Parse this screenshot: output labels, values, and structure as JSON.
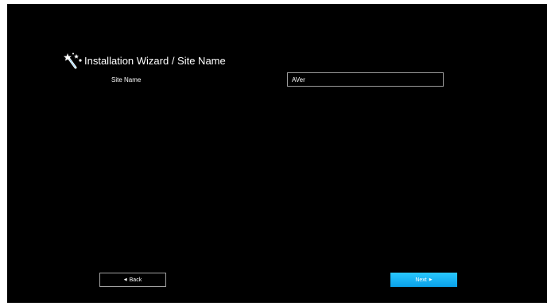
{
  "header": {
    "icon": "magic-wand-icon",
    "title": "Installation Wizard / Site Name"
  },
  "form": {
    "site_name_label": "Site Name",
    "site_name_value": "AVer"
  },
  "footer": {
    "back_label": "Back",
    "back_icon": "triangle-left-icon",
    "next_label": "Next",
    "next_icon": "triangle-right-icon"
  },
  "colors": {
    "background": "#000000",
    "accent": "#1eb4f5",
    "text": "#ffffff",
    "border": "#9a9a9a"
  }
}
